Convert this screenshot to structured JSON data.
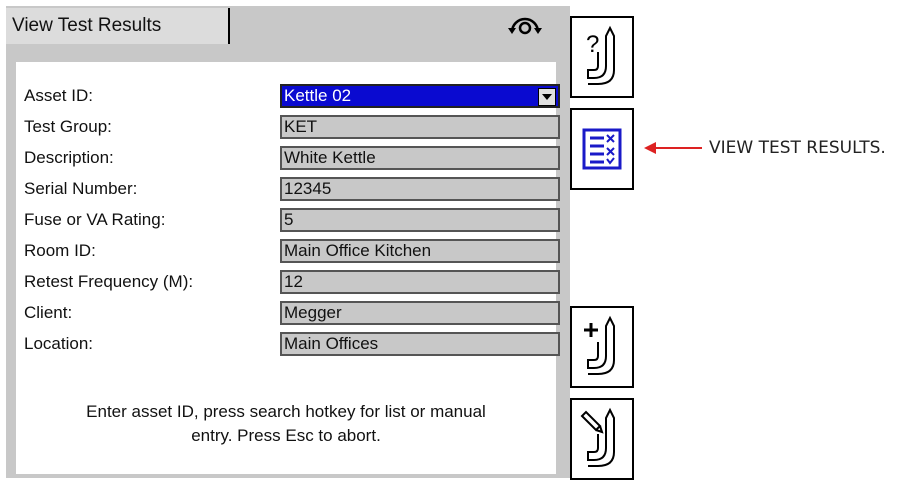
{
  "tab": {
    "title": "View Test Results"
  },
  "form": {
    "rows": [
      {
        "label": "Asset ID:",
        "value": "Kettle 02"
      },
      {
        "label": "Test Group:",
        "value": "KET"
      },
      {
        "label": "Description:",
        "value": "White Kettle"
      },
      {
        "label": "Serial Number:",
        "value": "12345"
      },
      {
        "label": "Fuse or VA Rating:",
        "value": "5"
      },
      {
        "label": "Room ID:",
        "value": "Main Office Kitchen"
      },
      {
        "label": "Retest Frequency (M):",
        "value": "12"
      },
      {
        "label": "Client:",
        "value": "Megger"
      },
      {
        "label": "Location:",
        "value": "Main Offices"
      }
    ],
    "help_line1": "Enter asset ID, press search hotkey for list or manual",
    "help_line2": "entry. Press Esc to abort."
  },
  "softkeys": {
    "icons": [
      "help-probe-icon",
      "view-results-icon",
      "add-probe-icon",
      "edit-probe-icon"
    ]
  },
  "annotation": {
    "text": "VIEW TEST RESULTS."
  },
  "colors": {
    "selected_field": "#0a0ad0",
    "panel": "#c8c8c8",
    "annotation": "#dd2222"
  }
}
